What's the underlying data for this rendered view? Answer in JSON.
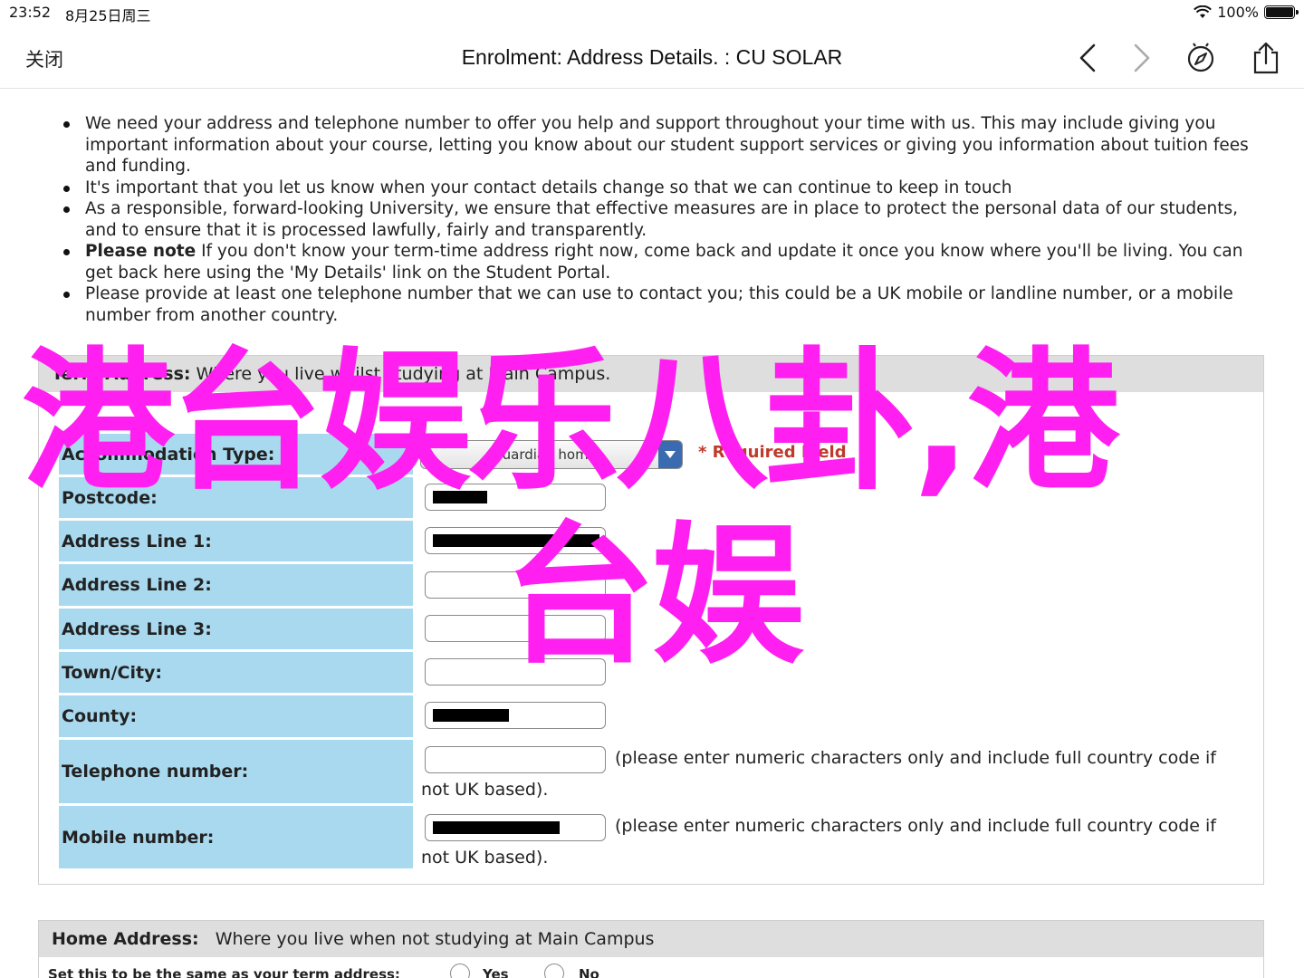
{
  "status_bar": {
    "time": "23:52",
    "date": "8月25日周三",
    "battery": "100%"
  },
  "nav": {
    "close_label": "关闭",
    "title": "Enrolment: Address Details. : CU SOLAR"
  },
  "bullets": [
    "We need your address and telephone number to offer you help and support throughout your time with us. This may include giving you important information about your course, letting you know about our student support services or giving you information about tuition fees and funding.",
    "It's important that you let us know when your contact details change so that we can continue to keep in touch",
    "As a responsible, forward-looking University, we ensure that effective measures are in place to protect the personal data of our students, and to ensure that it is processed lawfully, fairly and transparently.",
    {
      "bold": "Please note",
      "text": " If you don't know your term-time address right now, come back and update it once you know where you'll be living. You can get back here using the 'My Details' link on the Student Portal."
    },
    "Please provide at least one telephone number that we can use to contact you; this could be a UK mobile or landline number, or a mobile number from another country."
  ],
  "term_address": {
    "header_bold": "Term Address:",
    "header_text": " Where you live whilst studying at Main Campus.",
    "accommodation_label": "Accommodation Type:",
    "accommodation_value": "Guardian home",
    "required_text": "* Required Field",
    "fields": [
      {
        "label": "Postcode:",
        "redacted": true
      },
      {
        "label": "Address Line 1:",
        "redacted": true
      },
      {
        "label": "Address Line 2:",
        "redacted": false
      },
      {
        "label": "Address Line 3:",
        "redacted": false
      },
      {
        "label": "Town/City:",
        "redacted": false
      },
      {
        "label": "County:",
        "redacted": true
      }
    ],
    "telephone_label": "Telephone number:",
    "mobile_label": "Mobile number:",
    "phone_help": "(please enter numeric characters only and include full country code if not UK based)."
  },
  "home_address": {
    "header_bold": "Home Address:",
    "header_text": "Where you live when not studying at Main Campus",
    "same_as_label": "Set this to be the same as your term address:",
    "yes_label": "Yes",
    "no_label": "No"
  },
  "overlay": {
    "line1": "港台娱乐八卦,港",
    "line2": "台娱"
  },
  "colors": {
    "label_bg": "#a9d9ef",
    "overlay": "#ff1ff0",
    "header_bg": "#dedede"
  }
}
